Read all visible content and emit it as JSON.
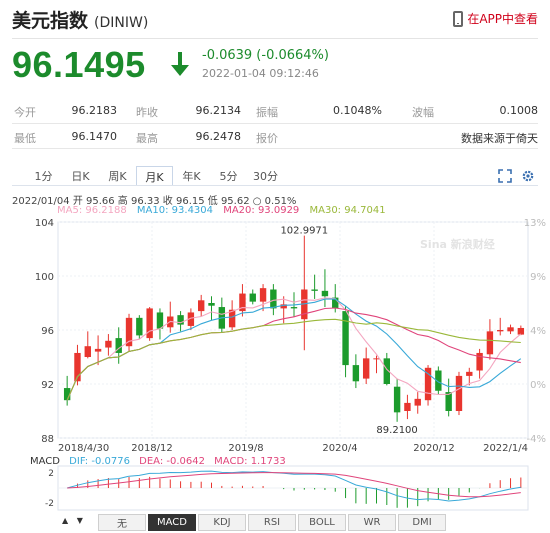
{
  "header": {
    "title": "美元指数",
    "code": "(DINIW)",
    "app_link": "在APP中查看"
  },
  "quote": {
    "price": "96.1495",
    "change": "-0.0639 (-0.0664%)",
    "time": "2022-01-04 09:12:46",
    "direction": "down",
    "color_down": "#1c8b2c"
  },
  "stats": {
    "row1": [
      {
        "label": "今开",
        "value": "96.2183"
      },
      {
        "label": "昨收",
        "value": "96.2134"
      },
      {
        "label": "振幅",
        "value": "0.1048%"
      },
      {
        "label": "波幅",
        "value": "0.1008"
      }
    ],
    "row2": [
      {
        "label": "最低",
        "value": "96.1470"
      },
      {
        "label": "最高",
        "value": "96.2478"
      },
      {
        "label": "报价",
        "value": "数据来源于倚天"
      }
    ]
  },
  "tabs": [
    {
      "label": "1分",
      "active": false
    },
    {
      "label": "日K",
      "active": false
    },
    {
      "label": "周K",
      "active": false
    },
    {
      "label": "月K",
      "active": true
    },
    {
      "label": "年K",
      "active": false
    },
    {
      "label": "5分",
      "active": false
    },
    {
      "label": "30分",
      "active": false
    }
  ],
  "toolbar_icons": [
    "fullscreen-icon",
    "settings-icon"
  ],
  "info_line": "2022/01/04 开 95.66 高 96.33 收 96.15 低 95.62 ○ 0.51%",
  "ma_legend": [
    {
      "label": "MA5: 96.2188",
      "color": "#f4a6c0"
    },
    {
      "label": "MA10: 93.4304",
      "color": "#39a9d8"
    },
    {
      "label": "MA20: 93.0929",
      "color": "#e0457b"
    },
    {
      "label": "MA30: 94.7041",
      "color": "#9ab83a"
    }
  ],
  "macd_legend": [
    {
      "label": "MACD",
      "color": "#333333"
    },
    {
      "label": "DIF: -0.0776",
      "color": "#39a9d8"
    },
    {
      "label": "DEA: -0.0642",
      "color": "#e0457b"
    },
    {
      "label": "MACD: 1.1733",
      "color": "#e0457b"
    }
  ],
  "bottom_tabs": [
    {
      "label": "无",
      "active": false
    },
    {
      "label": "MACD",
      "active": true
    },
    {
      "label": "KDJ",
      "active": false
    },
    {
      "label": "RSI",
      "active": false
    },
    {
      "label": "BOLL",
      "active": false
    },
    {
      "label": "WR",
      "active": false
    },
    {
      "label": "DMI",
      "active": false
    }
  ],
  "watermark": "Sina 新浪财经",
  "chart_data": {
    "type": "candlestick",
    "y_ticks": [
      "104",
      "100",
      "96",
      "92",
      "88"
    ],
    "ylim": [
      88,
      104
    ],
    "right_ticks": [
      "13%",
      "9%",
      "4%",
      "0%",
      "-4%"
    ],
    "x_ticks": [
      "2018/4/30",
      "2018/12",
      "2019/8",
      "2020/4",
      "2020/12",
      "2022/1/4"
    ],
    "annotations": {
      "max": "102.9971",
      "min": "89.2100"
    },
    "candles": [
      {
        "o": 91.7,
        "h": 92.6,
        "l": 90.4,
        "c": 90.8
      },
      {
        "o": 92.2,
        "h": 94.9,
        "l": 91.9,
        "c": 94.3
      },
      {
        "o": 94.0,
        "h": 95.9,
        "l": 93.9,
        "c": 94.8
      },
      {
        "o": 94.4,
        "h": 95.6,
        "l": 93.4,
        "c": 94.6
      },
      {
        "o": 94.7,
        "h": 95.7,
        "l": 94.1,
        "c": 95.2
      },
      {
        "o": 95.4,
        "h": 96.2,
        "l": 93.5,
        "c": 94.3
      },
      {
        "o": 94.8,
        "h": 97.2,
        "l": 94.4,
        "c": 96.9
      },
      {
        "o": 96.9,
        "h": 97.1,
        "l": 95.3,
        "c": 95.6
      },
      {
        "o": 95.4,
        "h": 97.7,
        "l": 95.2,
        "c": 97.6
      },
      {
        "o": 97.3,
        "h": 97.6,
        "l": 95.3,
        "c": 96.1
      },
      {
        "o": 96.2,
        "h": 98.1,
        "l": 95.8,
        "c": 97.0
      },
      {
        "o": 97.1,
        "h": 97.4,
        "l": 95.9,
        "c": 96.4
      },
      {
        "o": 96.3,
        "h": 97.6,
        "l": 96.0,
        "c": 97.3
      },
      {
        "o": 97.4,
        "h": 98.6,
        "l": 97.0,
        "c": 98.2
      },
      {
        "o": 98.0,
        "h": 98.5,
        "l": 96.7,
        "c": 97.8
      },
      {
        "o": 97.7,
        "h": 98.4,
        "l": 95.8,
        "c": 96.1
      },
      {
        "o": 96.2,
        "h": 98.2,
        "l": 96.0,
        "c": 97.5
      },
      {
        "o": 97.4,
        "h": 99.4,
        "l": 97.0,
        "c": 98.7
      },
      {
        "o": 98.7,
        "h": 99.0,
        "l": 97.9,
        "c": 98.1
      },
      {
        "o": 98.1,
        "h": 99.4,
        "l": 97.4,
        "c": 99.1
      },
      {
        "o": 99.0,
        "h": 99.4,
        "l": 97.1,
        "c": 97.6
      },
      {
        "o": 97.6,
        "h": 98.5,
        "l": 96.5,
        "c": 97.9
      },
      {
        "o": 97.7,
        "h": 98.8,
        "l": 97.0,
        "c": 97.6
      },
      {
        "o": 96.8,
        "h": 102.99,
        "l": 94.5,
        "c": 99.0
      },
      {
        "o": 99.0,
        "h": 100.1,
        "l": 98.3,
        "c": 98.9
      },
      {
        "o": 98.9,
        "h": 100.5,
        "l": 97.7,
        "c": 98.5
      },
      {
        "o": 98.4,
        "h": 99.4,
        "l": 97.3,
        "c": 97.6
      },
      {
        "o": 97.4,
        "h": 97.8,
        "l": 92.5,
        "c": 93.4
      },
      {
        "o": 93.4,
        "h": 94.2,
        "l": 91.7,
        "c": 92.2
      },
      {
        "o": 92.4,
        "h": 94.7,
        "l": 92.0,
        "c": 93.9
      },
      {
        "o": 93.9,
        "h": 94.1,
        "l": 92.8,
        "c": 93.9
      },
      {
        "o": 93.9,
        "h": 94.3,
        "l": 91.9,
        "c": 92.0
      },
      {
        "o": 91.8,
        "h": 92.4,
        "l": 89.2,
        "c": 89.9
      },
      {
        "o": 90.0,
        "h": 91.2,
        "l": 89.4,
        "c": 90.6
      },
      {
        "o": 90.4,
        "h": 91.4,
        "l": 89.8,
        "c": 90.9
      },
      {
        "o": 90.8,
        "h": 93.4,
        "l": 90.4,
        "c": 93.2
      },
      {
        "o": 93.0,
        "h": 93.3,
        "l": 91.2,
        "c": 91.5
      },
      {
        "o": 91.4,
        "h": 92.4,
        "l": 89.6,
        "c": 90.0
      },
      {
        "o": 90.0,
        "h": 92.9,
        "l": 89.7,
        "c": 92.6
      },
      {
        "o": 92.6,
        "h": 93.2,
        "l": 91.9,
        "c": 92.9
      },
      {
        "o": 93.0,
        "h": 94.6,
        "l": 92.4,
        "c": 94.3
      },
      {
        "o": 94.2,
        "h": 96.8,
        "l": 93.8,
        "c": 95.9
      },
      {
        "o": 95.9,
        "h": 96.9,
        "l": 95.6,
        "c": 96.0
      },
      {
        "o": 95.9,
        "h": 96.4,
        "l": 95.7,
        "c": 96.2
      },
      {
        "o": 95.66,
        "h": 96.33,
        "l": 95.62,
        "c": 96.15
      }
    ]
  }
}
